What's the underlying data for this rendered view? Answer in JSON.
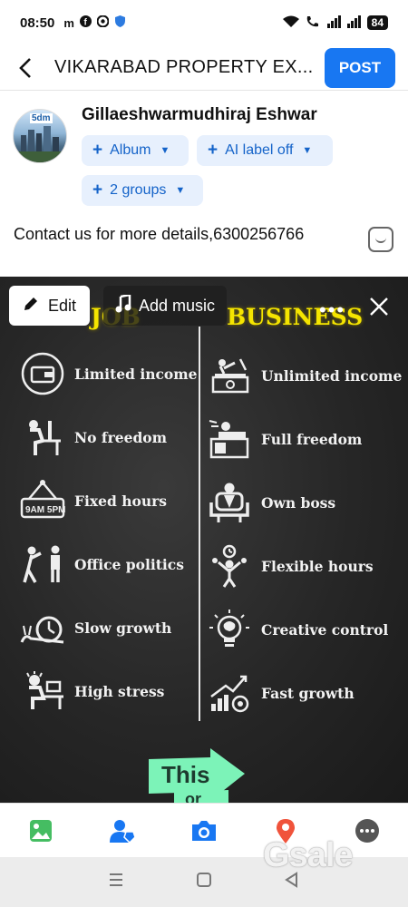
{
  "status": {
    "time": "08:50",
    "left_icons": [
      "m",
      "facebook-icon",
      "chrome-icon",
      "shield-icon"
    ],
    "battery": "84"
  },
  "header": {
    "title": "VIKARABAD PROPERTY EX...",
    "post_label": "POST"
  },
  "author": {
    "name": "Gillaeshwarmudhiraj Eshwar",
    "avatar_badge": "5dm",
    "chips": [
      {
        "label": "Album"
      },
      {
        "label": "AI label off"
      },
      {
        "label": "2 groups"
      }
    ]
  },
  "post": {
    "text": "Contact us for more details,6300256766"
  },
  "photo": {
    "edit_label": "Edit",
    "music_label": "Add music",
    "more": "•••",
    "left_heading": "JOB",
    "right_heading": "BUSINESS",
    "left_items": [
      {
        "label": "Limited income",
        "icon": "wallet-icon"
      },
      {
        "label": "No freedom",
        "icon": "desk-worker-icon"
      },
      {
        "label": "Fixed hours",
        "icon": "clock-sign-icon",
        "sign_text": "9AM 5PM"
      },
      {
        "label": "Office politics",
        "icon": "argument-icon"
      },
      {
        "label": "Slow growth",
        "icon": "snail-icon"
      },
      {
        "label": "High stress",
        "icon": "stressed-worker-icon"
      }
    ],
    "right_items": [
      {
        "label": "Unlimited income",
        "icon": "money-stack-icon"
      },
      {
        "label": "Full freedom",
        "icon": "relax-icon"
      },
      {
        "label": "Own boss",
        "icon": "boss-chair-icon"
      },
      {
        "label": "Flexible hours",
        "icon": "juggling-clock-icon"
      },
      {
        "label": "Creative control",
        "icon": "brain-bulb-icon"
      },
      {
        "label": "Fast growth",
        "icon": "growth-chart-icon"
      }
    ],
    "banner_text_1": "This",
    "banner_text_2": "or"
  },
  "toolbar": [
    "photo-icon",
    "tag-people-icon",
    "camera-icon",
    "location-icon",
    "more-options-icon"
  ],
  "watermark": "Gsale",
  "colors": {
    "accent": "#1877f2",
    "chip_bg": "#e7f0fd",
    "heading_yellow": "#f5e500",
    "banner_green": "#7cf3b8"
  }
}
